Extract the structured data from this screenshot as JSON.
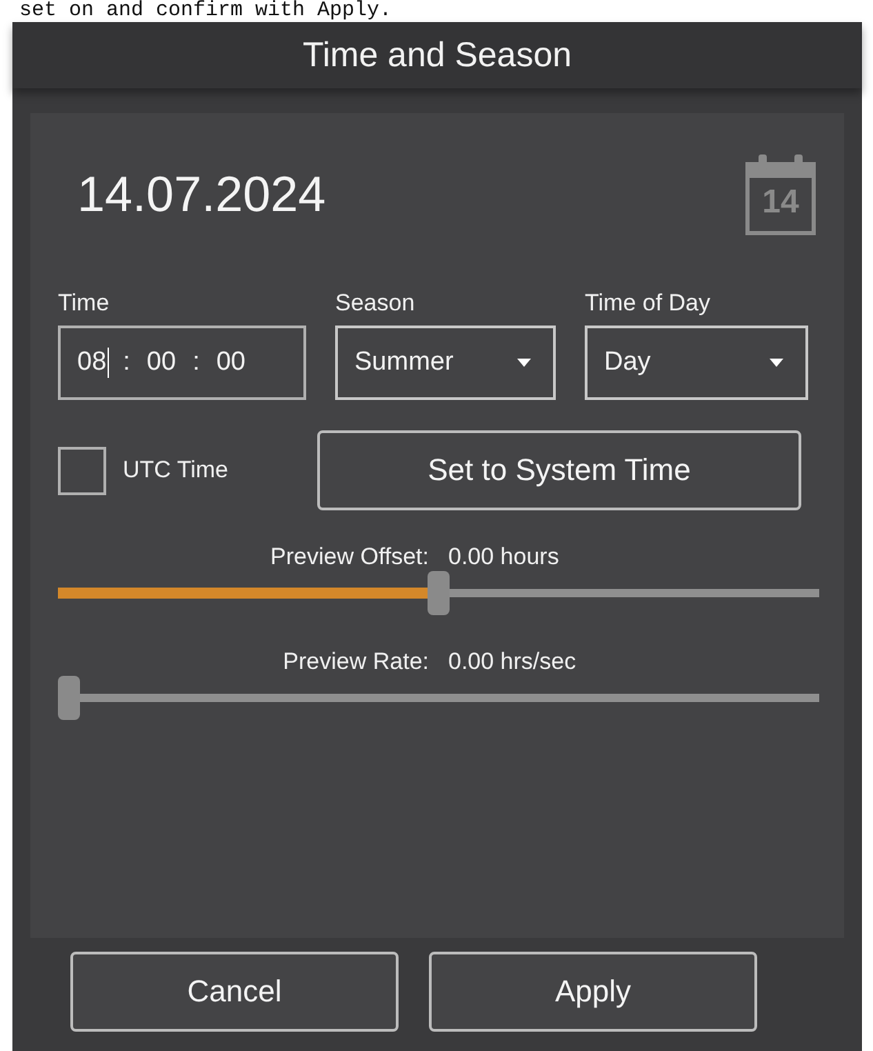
{
  "caption": "set on and confirm with Apply.",
  "window": {
    "title": "Time and Season"
  },
  "date": "14.07.2024",
  "calendar_day": "14",
  "time": {
    "label": "Time",
    "parts": [
      {
        "text": "08",
        "focused": true
      },
      {
        "text": ":",
        "focused": false
      },
      {
        "text": "00",
        "focused": false
      },
      {
        "text": ":",
        "focused": false
      },
      {
        "text": "00",
        "focused": false
      }
    ]
  },
  "season": {
    "label": "Season",
    "value": "Summer"
  },
  "time_of_day": {
    "label": "Time of Day",
    "value": "Day"
  },
  "utc_time": {
    "label": "UTC Time",
    "checked": false
  },
  "system_time_button": "Set to System Time",
  "sliders": [
    {
      "label": "Preview Offset:",
      "reading": "0.00 hours",
      "level": 0.5
    },
    {
      "label": "Preview Rate:",
      "reading": "0.00 hrs/sec",
      "level": 0
    }
  ],
  "buttons": [
    "Cancel",
    "Apply"
  ]
}
